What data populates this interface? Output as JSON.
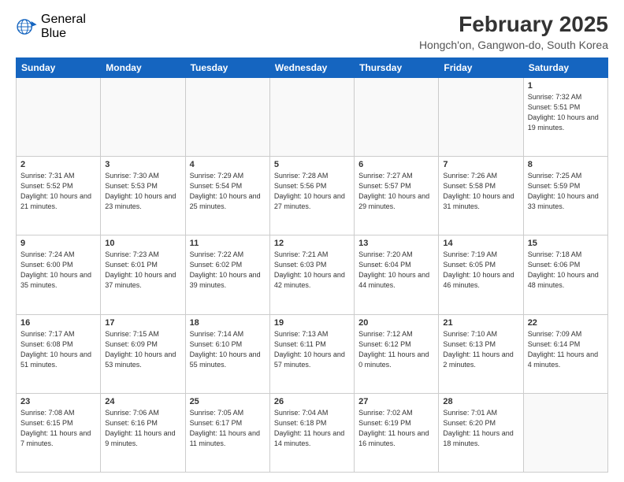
{
  "header": {
    "logo_line1": "General",
    "logo_line2": "Blue",
    "month_title": "February 2025",
    "location": "Hongch'on, Gangwon-do, South Korea"
  },
  "weekdays": [
    "Sunday",
    "Monday",
    "Tuesday",
    "Wednesday",
    "Thursday",
    "Friday",
    "Saturday"
  ],
  "weeks": [
    [
      {
        "day": "",
        "info": ""
      },
      {
        "day": "",
        "info": ""
      },
      {
        "day": "",
        "info": ""
      },
      {
        "day": "",
        "info": ""
      },
      {
        "day": "",
        "info": ""
      },
      {
        "day": "",
        "info": ""
      },
      {
        "day": "1",
        "info": "Sunrise: 7:32 AM\nSunset: 5:51 PM\nDaylight: 10 hours and 19 minutes."
      }
    ],
    [
      {
        "day": "2",
        "info": "Sunrise: 7:31 AM\nSunset: 5:52 PM\nDaylight: 10 hours and 21 minutes."
      },
      {
        "day": "3",
        "info": "Sunrise: 7:30 AM\nSunset: 5:53 PM\nDaylight: 10 hours and 23 minutes."
      },
      {
        "day": "4",
        "info": "Sunrise: 7:29 AM\nSunset: 5:54 PM\nDaylight: 10 hours and 25 minutes."
      },
      {
        "day": "5",
        "info": "Sunrise: 7:28 AM\nSunset: 5:56 PM\nDaylight: 10 hours and 27 minutes."
      },
      {
        "day": "6",
        "info": "Sunrise: 7:27 AM\nSunset: 5:57 PM\nDaylight: 10 hours and 29 minutes."
      },
      {
        "day": "7",
        "info": "Sunrise: 7:26 AM\nSunset: 5:58 PM\nDaylight: 10 hours and 31 minutes."
      },
      {
        "day": "8",
        "info": "Sunrise: 7:25 AM\nSunset: 5:59 PM\nDaylight: 10 hours and 33 minutes."
      }
    ],
    [
      {
        "day": "9",
        "info": "Sunrise: 7:24 AM\nSunset: 6:00 PM\nDaylight: 10 hours and 35 minutes."
      },
      {
        "day": "10",
        "info": "Sunrise: 7:23 AM\nSunset: 6:01 PM\nDaylight: 10 hours and 37 minutes."
      },
      {
        "day": "11",
        "info": "Sunrise: 7:22 AM\nSunset: 6:02 PM\nDaylight: 10 hours and 39 minutes."
      },
      {
        "day": "12",
        "info": "Sunrise: 7:21 AM\nSunset: 6:03 PM\nDaylight: 10 hours and 42 minutes."
      },
      {
        "day": "13",
        "info": "Sunrise: 7:20 AM\nSunset: 6:04 PM\nDaylight: 10 hours and 44 minutes."
      },
      {
        "day": "14",
        "info": "Sunrise: 7:19 AM\nSunset: 6:05 PM\nDaylight: 10 hours and 46 minutes."
      },
      {
        "day": "15",
        "info": "Sunrise: 7:18 AM\nSunset: 6:06 PM\nDaylight: 10 hours and 48 minutes."
      }
    ],
    [
      {
        "day": "16",
        "info": "Sunrise: 7:17 AM\nSunset: 6:08 PM\nDaylight: 10 hours and 51 minutes."
      },
      {
        "day": "17",
        "info": "Sunrise: 7:15 AM\nSunset: 6:09 PM\nDaylight: 10 hours and 53 minutes."
      },
      {
        "day": "18",
        "info": "Sunrise: 7:14 AM\nSunset: 6:10 PM\nDaylight: 10 hours and 55 minutes."
      },
      {
        "day": "19",
        "info": "Sunrise: 7:13 AM\nSunset: 6:11 PM\nDaylight: 10 hours and 57 minutes."
      },
      {
        "day": "20",
        "info": "Sunrise: 7:12 AM\nSunset: 6:12 PM\nDaylight: 11 hours and 0 minutes."
      },
      {
        "day": "21",
        "info": "Sunrise: 7:10 AM\nSunset: 6:13 PM\nDaylight: 11 hours and 2 minutes."
      },
      {
        "day": "22",
        "info": "Sunrise: 7:09 AM\nSunset: 6:14 PM\nDaylight: 11 hours and 4 minutes."
      }
    ],
    [
      {
        "day": "23",
        "info": "Sunrise: 7:08 AM\nSunset: 6:15 PM\nDaylight: 11 hours and 7 minutes."
      },
      {
        "day": "24",
        "info": "Sunrise: 7:06 AM\nSunset: 6:16 PM\nDaylight: 11 hours and 9 minutes."
      },
      {
        "day": "25",
        "info": "Sunrise: 7:05 AM\nSunset: 6:17 PM\nDaylight: 11 hours and 11 minutes."
      },
      {
        "day": "26",
        "info": "Sunrise: 7:04 AM\nSunset: 6:18 PM\nDaylight: 11 hours and 14 minutes."
      },
      {
        "day": "27",
        "info": "Sunrise: 7:02 AM\nSunset: 6:19 PM\nDaylight: 11 hours and 16 minutes."
      },
      {
        "day": "28",
        "info": "Sunrise: 7:01 AM\nSunset: 6:20 PM\nDaylight: 11 hours and 18 minutes."
      },
      {
        "day": "",
        "info": ""
      }
    ]
  ]
}
